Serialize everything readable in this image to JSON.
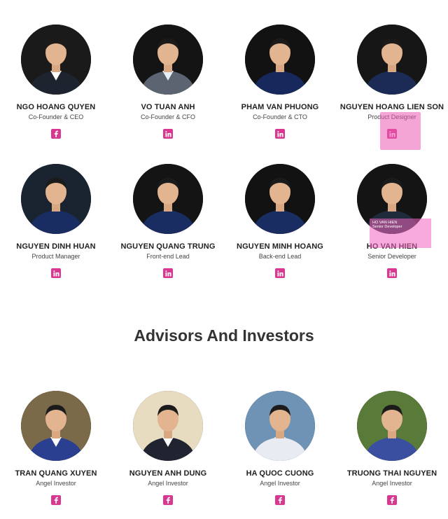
{
  "team": [
    {
      "name": "NGO HOANG QUYEN",
      "role": "Co-Founder & CEO",
      "social": "facebook-icon",
      "bg": "#1a1a1a",
      "shirt": "#1e2330",
      "collar": "#ffffff"
    },
    {
      "name": "VO TUAN ANH",
      "role": "Co-Founder & CFO",
      "social": "linkedin-icon",
      "bg": "#141414",
      "shirt": "#5b6470",
      "collar": "#e8eef5"
    },
    {
      "name": "PHAM VAN PHUONG",
      "role": "Co-Founder & CTO",
      "social": "linkedin-icon",
      "bg": "#121212",
      "shirt": "#17295c",
      "collar": "#17295c"
    },
    {
      "name": "NGUYEN HOANG LIEN SON",
      "role": "Product Designer",
      "social": "linkedin-icon",
      "bg": "#161616",
      "shirt": "#1b2b55",
      "collar": "#1b2b55"
    },
    {
      "name": "NGUYEN DINH HUAN",
      "role": "Product Manager",
      "social": "linkedin-icon",
      "bg": "#1a2330",
      "shirt": "#1a2d63",
      "collar": "#1a2d63"
    },
    {
      "name": "NGUYEN QUANG TRUNG",
      "role": "Front-end Lead",
      "social": "linkedin-icon",
      "bg": "#141414",
      "shirt": "#1a2d63",
      "collar": "#1a2d63"
    },
    {
      "name": "NGUYEN MINH HOANG",
      "role": "Back-end Lead",
      "social": "linkedin-icon",
      "bg": "#121212",
      "shirt": "#1a2d63",
      "collar": "#1a2d63"
    },
    {
      "name": "HO VAN HIEN",
      "role": "Senior Developer",
      "social": "linkedin-icon",
      "bg": "#141414",
      "shirt": "#1f2a3a",
      "collar": "#1f2a3a"
    }
  ],
  "hover_bio": {
    "name": "HO VAN HIEN",
    "role": "Senior Developer"
  },
  "advisors_title": "Advisors And Investors",
  "advisors": [
    {
      "name": "TRAN QUANG XUYEN",
      "role": "Angel Investor",
      "social": "facebook-icon",
      "bg": "#7a6a4a",
      "shirt": "#2a3f8f",
      "collar": "#ffffff"
    },
    {
      "name": "NGUYEN ANH DUNG",
      "role": "Angel Investor",
      "social": "facebook-icon",
      "bg": "#e8dcc0",
      "shirt": "#1f2430",
      "collar": "#ffffff"
    },
    {
      "name": "HA QUOC CUONG",
      "role": "Angel Investor",
      "social": "facebook-icon",
      "bg": "#6f93b5",
      "shirt": "#e8ecf2",
      "collar": "#e8ecf2"
    },
    {
      "name": "TRUONG THAI NGUYEN",
      "role": "Angel Investor",
      "social": "facebook-icon",
      "bg": "#5a7a3a",
      "shirt": "#3a4fa0",
      "collar": "#3a4fa0"
    }
  ]
}
